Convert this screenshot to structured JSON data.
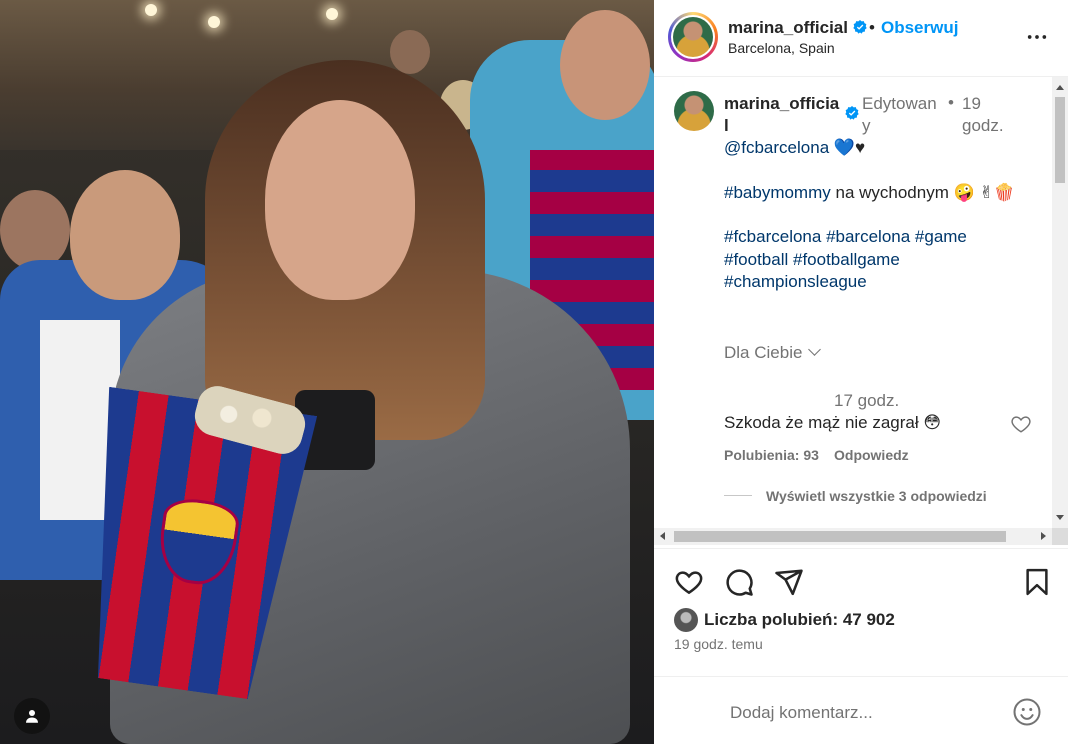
{
  "header": {
    "username": "marina_official",
    "dot": "•",
    "follow_label": "Obserwuj",
    "location": "Barcelona, Spain"
  },
  "caption": {
    "username": "marina_official",
    "edited": "Edytowany",
    "dot": "•",
    "time": "19 godz.",
    "mention": "@fcbarcelona",
    "mention_emoji": "💙♥",
    "line2_tag": "#babymommy",
    "line2_text": " na wychodnym ",
    "line2_emoji": "🤪 ✌🍿",
    "tags_line1": "#fcbarcelona #barcelona #game",
    "tags_line2": "#football #footballgame",
    "tags_line3": "#championsleague",
    "for_you": "Dla Ciebie"
  },
  "comment": {
    "time": "17 godz.",
    "text": "Szkoda że mąż nie zagrał 😳",
    "likes": "Polubienia: 93",
    "reply": "Odpowiedz",
    "view_replies": "Wyświetl wszystkie 3 odpowiedzi"
  },
  "post": {
    "likes_label": "Liczba polubień: 47 902",
    "posted_ago": "19 godz. temu"
  },
  "add_comment": {
    "placeholder": "Dodaj komentarz..."
  },
  "icons": {
    "verified": "verified-badge-icon",
    "more": "more-options-icon",
    "like": "heart-icon",
    "comment": "comment-icon",
    "share": "share-icon",
    "save": "bookmark-icon",
    "emoji": "emoji-icon",
    "user": "user-icon"
  },
  "colors": {
    "accent": "#0095f6",
    "hashtag": "#00376b",
    "secondary_text": "#737373"
  }
}
